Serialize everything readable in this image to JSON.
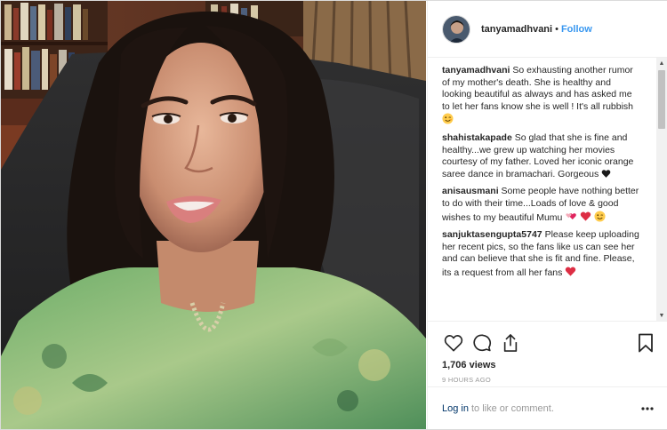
{
  "header": {
    "username": "tanyamadhvani",
    "separator": "•",
    "follow_label": "Follow"
  },
  "comments": [
    {
      "user": "tanyamadhvani",
      "text": "So exhausting another rumor of my mother's death. She is healthy and looking beautiful as always and has asked me to let her fans know she is well ! It's all rubbish",
      "emoji": [
        "wink-face"
      ]
    },
    {
      "user": "shahistakapade",
      "text": "So glad that she is fine and healthy...we grew up watching her movies courtesy of my father. Loved her iconic orange saree dance in bramachari. Gorgeous",
      "emoji": [
        "black-heart"
      ]
    },
    {
      "user": "anisausmani",
      "text": "Some people have nothing better to do with their time...Loads of love & good wishes to my beautiful Mumu",
      "emoji": [
        "two-hearts",
        "red-heart",
        "wink-face"
      ]
    },
    {
      "user": "sanjuktasengupta5747",
      "text": "Please keep uploading her recent pics, so the fans like us can see her and can believe that she is fit and fine. Please, its a request from all her fans",
      "emoji": [
        "red-heart"
      ]
    }
  ],
  "stats": {
    "views": "1,706 views",
    "time": "9 HOURS AGO"
  },
  "footer": {
    "login_label": "Log in",
    "login_suffix": "to like or comment."
  },
  "colors": {
    "link_blue": "#3897f0",
    "login_link": "#003569",
    "heart_red": "#e0245e"
  }
}
